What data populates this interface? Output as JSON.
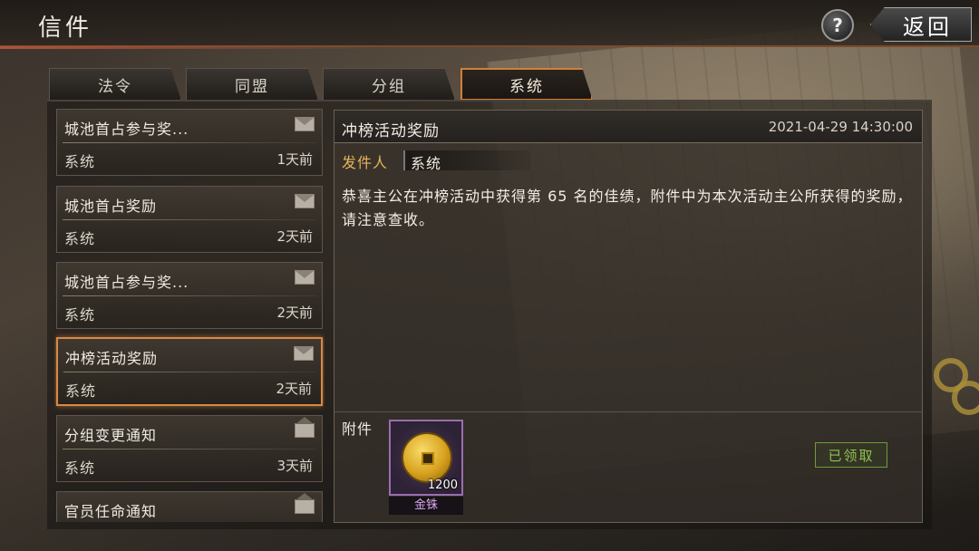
{
  "header": {
    "title": "信件",
    "help_label": "?",
    "back_label": "返回"
  },
  "tabs": [
    {
      "label": "法令",
      "active": false
    },
    {
      "label": "同盟",
      "active": false
    },
    {
      "label": "分组",
      "active": false
    },
    {
      "label": "系统",
      "active": true
    }
  ],
  "mail_list": [
    {
      "subject": "城池首占参与奖...",
      "sender": "系统",
      "time": "1天前",
      "read": false,
      "selected": false
    },
    {
      "subject": "城池首占奖励",
      "sender": "系统",
      "time": "2天前",
      "read": false,
      "selected": false
    },
    {
      "subject": "城池首占参与奖...",
      "sender": "系统",
      "time": "2天前",
      "read": false,
      "selected": false
    },
    {
      "subject": "冲榜活动奖励",
      "sender": "系统",
      "time": "2天前",
      "read": false,
      "selected": true
    },
    {
      "subject": "分组变更通知",
      "sender": "系统",
      "time": "3天前",
      "read": true,
      "selected": false
    },
    {
      "subject": "官员任命通知",
      "sender": "",
      "time": "",
      "read": true,
      "selected": false
    }
  ],
  "detail": {
    "title": "冲榜活动奖励",
    "date": "2021-04-29 14:30:00",
    "sender_label": "发件人",
    "sender": "系统",
    "body": "恭喜主公在冲榜活动中获得第 65 名的佳绩，附件中为本次活动主公所获得的奖励，请注意查收。",
    "attachment_label": "附件",
    "attachment": {
      "icon": "gold-coin-icon",
      "count": "1200",
      "name": "金铢"
    },
    "claim_label": "已领取"
  },
  "colors": {
    "accent": "#d88a45",
    "sender_label": "#e8b45a",
    "claimed": "#8fc24a",
    "item_rarity": "#9a6eb0"
  }
}
